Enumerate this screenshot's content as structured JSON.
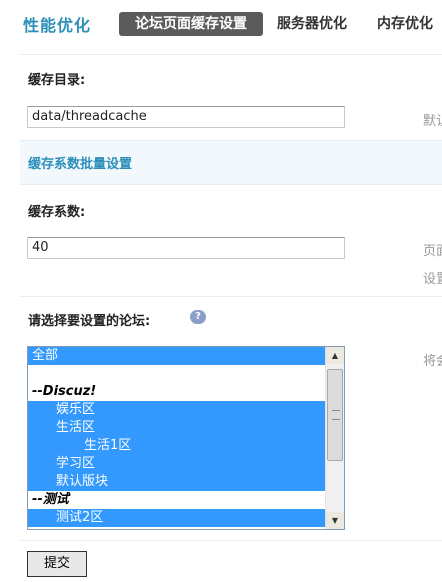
{
  "header": {
    "title": "性能优化",
    "tabs": [
      {
        "label": "论坛页面缓存设置",
        "active": true
      },
      {
        "label": "服务器优化",
        "active": false
      },
      {
        "label": "内存优化",
        "active": false
      }
    ]
  },
  "cache_dir": {
    "label": "缓存目录:",
    "value": "data/threadcache",
    "tip": "默认"
  },
  "section": {
    "title": "缓存系数批量设置"
  },
  "cache_factor": {
    "label": "缓存系数:",
    "value": "40",
    "tip_line1": "页面",
    "tip_line2": "设置"
  },
  "forum_select": {
    "label": "请选择要设置的论坛:",
    "help_icon": "help-bubble-icon",
    "tip": "将会",
    "options": [
      {
        "text": "全部",
        "type": "selected",
        "indent": 0
      },
      {
        "text": "",
        "type": "blank",
        "indent": 0
      },
      {
        "text": "--Discuz!",
        "type": "group",
        "indent": 0
      },
      {
        "text": "娱乐区",
        "type": "selected",
        "indent": 1
      },
      {
        "text": "生活区",
        "type": "selected",
        "indent": 1
      },
      {
        "text": "生活1区",
        "type": "selected",
        "indent": 2
      },
      {
        "text": "学习区",
        "type": "selected",
        "indent": 1
      },
      {
        "text": "默认版块",
        "type": "selected",
        "indent": 1
      },
      {
        "text": "--测试",
        "type": "group",
        "indent": 0
      },
      {
        "text": "测试2区",
        "type": "selected",
        "indent": 1
      }
    ]
  },
  "submit": {
    "label": "提交"
  },
  "colors": {
    "accent": "#2b8fb9",
    "selection": "#3399ff",
    "active_tab": "#5b5b5b"
  }
}
